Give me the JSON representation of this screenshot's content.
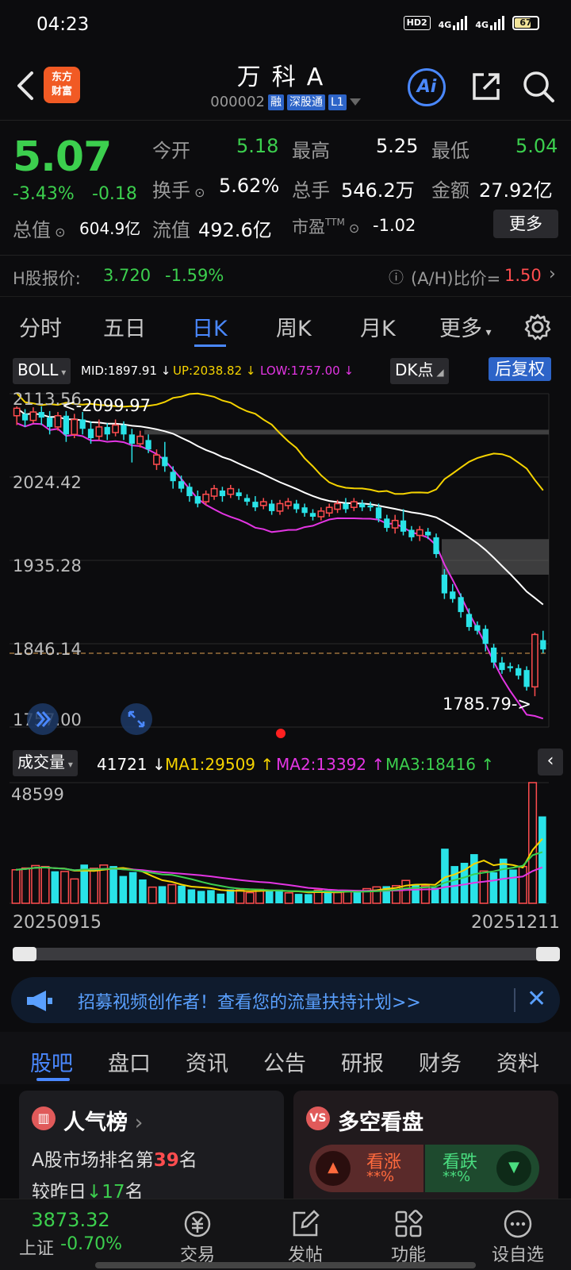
{
  "status_bar": {
    "time": "04:23",
    "hd": "HD2",
    "net1": "4G",
    "net2": "4G",
    "battery": "67"
  },
  "header": {
    "logo_line1": "东方",
    "logo_line2": "财富",
    "name": "万科A",
    "code": "000002",
    "tag_rong": "融",
    "tag_sgt": "深股通",
    "tag_level": "L1",
    "ai_label": "Ai"
  },
  "quote": {
    "price": "5.07",
    "pct": "-3.43%",
    "change": "-0.18",
    "open_label": "今开",
    "open": "5.18",
    "high_label": "最高",
    "high": "5.25",
    "low_label": "最低",
    "low": "5.04",
    "turnover_label": "换手",
    "turnover": "5.62%",
    "volume_label": "总手",
    "volume": "546.2万",
    "amount_label": "金额",
    "amount": "27.92亿",
    "mktcap_label": "总值",
    "mktcap": "604.9亿",
    "float_label": "流值",
    "float": "492.6亿",
    "pe_label": "市盈",
    "pe_sup": "TTM",
    "pe": "-1.02",
    "more": "更多"
  },
  "hshare": {
    "label": "H股报价:",
    "price": "3.720",
    "pct": "-1.59%",
    "ratio_label": "(A/H)比价=",
    "ratio": "1.50"
  },
  "ktabs": [
    "分时",
    "五日",
    "日K",
    "周K",
    "月K",
    "更多"
  ],
  "indicator": {
    "name": "BOLL",
    "mid": "MID:1897.91",
    "up": "UP:2038.82",
    "low": "LOW:1757.00",
    "dk": "DK点",
    "fq": "后复权"
  },
  "volume_row": {
    "name": "成交量",
    "vol": "41721",
    "ma1": "MA1:29509",
    "ma2": "MA2:13392",
    "ma3": "MA3:18416"
  },
  "chart_data": {
    "type": "candlestick",
    "y_ticks": [
      "2113.56",
      "2024.42",
      "1935.28",
      "1846.14",
      "1757.00"
    ],
    "ylim": [
      1757.0,
      2113.56
    ],
    "high_marker": "<-2099.97",
    "low_marker": "1785.79->",
    "vol_max_label": "48599",
    "x_start": "20250915",
    "x_end": "20251211",
    "candles": [
      [
        2090,
        2098,
        2080,
        2100
      ],
      [
        2092,
        2085,
        2078,
        2097
      ],
      [
        2085,
        2094,
        2082,
        2099
      ],
      [
        2094,
        2088,
        2080,
        2100
      ],
      [
        2088,
        2078,
        2070,
        2095
      ],
      [
        2078,
        2090,
        2074,
        2094
      ],
      [
        2090,
        2070,
        2062,
        2095
      ],
      [
        2070,
        2086,
        2066,
        2092
      ],
      [
        2086,
        2076,
        2070,
        2094
      ],
      [
        2076,
        2066,
        2060,
        2084
      ],
      [
        2068,
        2078,
        2064,
        2086
      ],
      [
        2078,
        2070,
        2064,
        2082
      ],
      [
        2072,
        2080,
        2068,
        2086
      ],
      [
        2080,
        2070,
        2064,
        2084
      ],
      [
        2070,
        2060,
        2040,
        2076
      ],
      [
        2060,
        2068,
        2056,
        2074
      ],
      [
        2064,
        2054,
        2050,
        2070
      ],
      [
        2038,
        2048,
        2032,
        2054
      ],
      [
        2046,
        2036,
        2030,
        2062
      ],
      [
        2030,
        2020,
        2012,
        2036
      ],
      [
        2020,
        2012,
        2008,
        2026
      ],
      [
        2014,
        2004,
        1998,
        2018
      ],
      [
        2004,
        1996,
        1992,
        2010
      ],
      [
        1998,
        2006,
        1994,
        2010
      ],
      [
        2004,
        2012,
        2000,
        2016
      ],
      [
        2010,
        2004,
        1998,
        2014
      ],
      [
        2006,
        2012,
        2002,
        2016
      ],
      [
        2008,
        2004,
        2000,
        2012
      ],
      [
        2002,
        1998,
        1994,
        2006
      ],
      [
        1998,
        1992,
        1988,
        2004
      ],
      [
        1994,
        1998,
        1990,
        2002
      ],
      [
        1996,
        1988,
        1984,
        2000
      ],
      [
        1988,
        1996,
        1984,
        2000
      ],
      [
        1994,
        1998,
        1990,
        2002
      ],
      [
        1996,
        1990,
        1986,
        2000
      ],
      [
        1992,
        1986,
        1982,
        1996
      ],
      [
        1986,
        1982,
        1978,
        1990
      ],
      [
        1982,
        1988,
        1978,
        1992
      ],
      [
        1986,
        1992,
        1982,
        1996
      ],
      [
        1990,
        1996,
        1986,
        2000
      ],
      [
        1996,
        1990,
        1986,
        2002
      ],
      [
        1992,
        1998,
        1988,
        2002
      ],
      [
        1996,
        1992,
        1988,
        2000
      ],
      [
        1994,
        1992,
        1988,
        1998
      ],
      [
        1992,
        1980,
        1976,
        1996
      ],
      [
        1980,
        1970,
        1966,
        1984
      ],
      [
        1970,
        1978,
        1964,
        1984
      ],
      [
        1978,
        1966,
        1962,
        1990
      ],
      [
        1968,
        1960,
        1956,
        1972
      ],
      [
        1962,
        1968,
        1956,
        1972
      ],
      [
        1966,
        1962,
        1958,
        1970
      ],
      [
        1960,
        1942,
        1938,
        1964
      ],
      [
        1920,
        1900,
        1894,
        1926
      ],
      [
        1902,
        1894,
        1890,
        1910
      ],
      [
        1896,
        1880,
        1874,
        1900
      ],
      [
        1878,
        1864,
        1860,
        1884
      ],
      [
        1866,
        1860,
        1856,
        1870
      ],
      [
        1862,
        1846,
        1838,
        1866
      ],
      [
        1842,
        1826,
        1820,
        1846
      ],
      [
        1826,
        1818,
        1814,
        1832
      ],
      [
        1822,
        1820,
        1816,
        1826
      ],
      [
        1820,
        1812,
        1808,
        1824
      ],
      [
        1818,
        1800,
        1796,
        1822
      ],
      [
        1800,
        1856,
        1790,
        1858
      ],
      [
        1850,
        1840,
        1836,
        1860
      ]
    ],
    "volumes": [
      [
        13500,
        "r"
      ],
      [
        14200,
        "r"
      ],
      [
        15200,
        "r"
      ],
      [
        14800,
        "r"
      ],
      [
        12900,
        "c"
      ],
      [
        12800,
        "r"
      ],
      [
        9800,
        "r"
      ],
      [
        15600,
        "c"
      ],
      [
        14100,
        "r"
      ],
      [
        15400,
        "r"
      ],
      [
        15000,
        "c"
      ],
      [
        11000,
        "c"
      ],
      [
        12600,
        "c"
      ],
      [
        9600,
        "c"
      ],
      [
        6500,
        "r"
      ],
      [
        6900,
        "c"
      ],
      [
        7500,
        "r"
      ],
      [
        7100,
        "c"
      ],
      [
        5600,
        "c"
      ],
      [
        5000,
        "c"
      ],
      [
        5300,
        "c"
      ],
      [
        3900,
        "c"
      ],
      [
        5600,
        "c"
      ],
      [
        5400,
        "r"
      ],
      [
        4300,
        "r"
      ],
      [
        5600,
        "r"
      ],
      [
        4900,
        "c"
      ],
      [
        5500,
        "c"
      ],
      [
        4200,
        "r"
      ],
      [
        3800,
        "c"
      ],
      [
        3700,
        "c"
      ],
      [
        5300,
        "r"
      ],
      [
        5200,
        "c"
      ],
      [
        4300,
        "r"
      ],
      [
        5000,
        "r"
      ],
      [
        4500,
        "c"
      ],
      [
        5900,
        "r"
      ],
      [
        6600,
        "r"
      ],
      [
        6900,
        "c"
      ],
      [
        7100,
        "r"
      ],
      [
        9200,
        "r"
      ],
      [
        7700,
        "c"
      ],
      [
        7000,
        "r"
      ],
      [
        6300,
        "c"
      ],
      [
        22000,
        "c"
      ],
      [
        15000,
        "c"
      ],
      [
        16300,
        "c"
      ],
      [
        19800,
        "c"
      ],
      [
        13000,
        "r"
      ],
      [
        12500,
        "c"
      ],
      [
        18000,
        "c"
      ],
      [
        13600,
        "c"
      ],
      [
        14800,
        "r"
      ],
      [
        48599,
        "r"
      ],
      [
        35000,
        "c"
      ]
    ]
  },
  "dates": {
    "start": "20250915",
    "end": "20251211"
  },
  "banner": {
    "text": "招募视频创作者！查看您的流量扶持计划>>"
  },
  "btabs": [
    "股吧",
    "盘口",
    "资讯",
    "公告",
    "研报",
    "财务",
    "资料"
  ],
  "cards": {
    "hot_title": "人气榜",
    "hot_rank_prefix": "A股市场排名第",
    "hot_rank": "39",
    "hot_rank_suffix": "名",
    "hot_change_prefix": "较昨日",
    "hot_change": "17",
    "hot_change_suffix": "名",
    "vs_title": "多空看盘",
    "bull": "看涨",
    "bull_pct": "**%",
    "bear": "看跌",
    "bear_pct": "**%"
  },
  "bottom_nav": {
    "index_value": "3873.32",
    "index_name": "上证",
    "index_pct": "-0.70%",
    "items": [
      "交易",
      "发帖",
      "功能",
      "设自选"
    ]
  },
  "colors": {
    "up": "#ff4d4f",
    "down": "#3ccf4e",
    "candle_down": "#29e3e8",
    "accent": "#4a88ff"
  }
}
